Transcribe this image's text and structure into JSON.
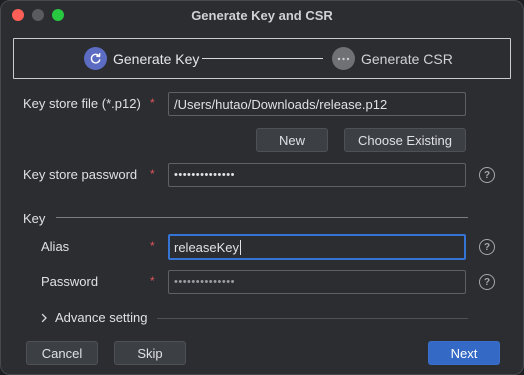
{
  "window": {
    "title": "Generate Key and CSR"
  },
  "steps": [
    {
      "label": "Generate Key",
      "state": "active"
    },
    {
      "label": "Generate CSR",
      "state": "inactive"
    }
  ],
  "keystore": {
    "file_label": "Key store file (*.p12)",
    "file_value": "/Users/hutao/Downloads/release.p12",
    "new_label": "New",
    "choose_label": "Choose Existing",
    "password_label": "Key store password",
    "password_mask": "••••••••••••••"
  },
  "key": {
    "section_label": "Key",
    "alias_label": "Alias",
    "alias_value": "releaseKey",
    "password_label": "Password",
    "password_mask": "••••••••••••••",
    "advance_label": "Advance setting"
  },
  "required_mark": "*",
  "help_glyph": "?",
  "footer": {
    "cancel_label": "Cancel",
    "skip_label": "Skip",
    "next_label": "Next"
  },
  "colors": {
    "accent": "#3574d4",
    "primary_button": "#3469c5",
    "required": "#e0555c",
    "step_active": "#5b6cc2"
  },
  "icons": {
    "step_active": "refresh-icon",
    "step_inactive": "ellipsis-icon",
    "advance": "chevron-right-icon",
    "help": "help-icon"
  }
}
